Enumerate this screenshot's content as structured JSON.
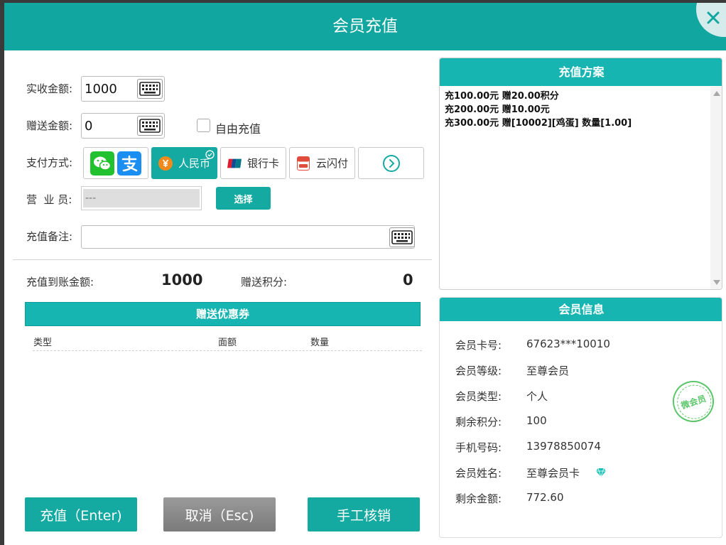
{
  "window": {
    "title": "会员充值"
  },
  "form": {
    "actual_amount_label": "实收金额:",
    "actual_amount_value": "1000",
    "gift_amount_label": "赠送金额:",
    "gift_amount_value": "0",
    "free_recharge_label": "自由充值",
    "free_recharge_checked": false,
    "payment_label": "支付方式:",
    "payment_methods": [
      "人民币",
      "银行卡",
      "云闪付"
    ],
    "payment_selected": "人民币",
    "salesperson_label": "营  业 员:",
    "salesperson_placeholder": "---",
    "select_button": "选择",
    "remark_label": "充值备注:",
    "remark_value": ""
  },
  "summary": {
    "credited_label": "充值到账金额:",
    "credited_value": "1000",
    "points_label": "赠送积分:",
    "points_value": "0"
  },
  "coupons": {
    "title": "赠送优惠券",
    "columns": [
      "类型",
      "面额",
      "数量"
    ],
    "rows": []
  },
  "actions": {
    "recharge": "充值（Enter)",
    "cancel": "取消（Esc)",
    "manual": "手工核销"
  },
  "plans": {
    "title": "充值方案",
    "items": [
      "充100.00元 赠20.00积分",
      "充200.00元 赠10.00元",
      "充300.00元 赠[10002][鸡蛋] 数量[1.00]"
    ]
  },
  "member": {
    "title": "会员信息",
    "fields": [
      {
        "label": "会员卡号:",
        "value": "67623***10010"
      },
      {
        "label": "会员等级:",
        "value": "至尊会员"
      },
      {
        "label": "会员类型:",
        "value": "个人"
      },
      {
        "label": "剩余积分:",
        "value": "100"
      },
      {
        "label": "手机号码:",
        "value": "13978850074"
      },
      {
        "label": "会员姓名:",
        "value": "至尊会员卡"
      },
      {
        "label": "剩余金额:",
        "value": "772.60"
      }
    ],
    "stamp_text": "微会员"
  },
  "colors": {
    "accent": "#14aaa2",
    "header": "#16b5b1",
    "cancel": "#8a8a8a",
    "stamp": "#5cc66a"
  },
  "icons": [
    "close-icon",
    "keyboard-icon",
    "wechat-pay-icon",
    "alipay-icon",
    "rmb-icon",
    "unionpay-icon",
    "quickpass-icon",
    "more-icon",
    "check-icon",
    "diamond-icon"
  ]
}
